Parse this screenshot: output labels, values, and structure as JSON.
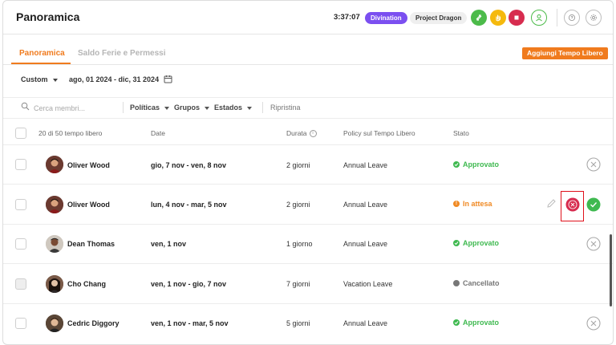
{
  "header": {
    "title": "Panoramica",
    "time": "3:37:07",
    "workspace_badge": "Divination",
    "project_badge": "Project Dragon",
    "icons": [
      "switch-icon",
      "hand-icon",
      "stop-icon",
      "user-icon",
      "help-icon",
      "settings-icon"
    ]
  },
  "tabs": [
    {
      "label": "Panoramica",
      "active": true
    },
    {
      "label": "Saldo Ferie e Permessi",
      "active": false
    }
  ],
  "add_button": "Aggiungi Tempo Libero",
  "range": {
    "preset": "Custom",
    "dates": "ago, 01 2024 - dic, 31 2024"
  },
  "filters": {
    "search_placeholder": "Cerca membri...",
    "policies": "Políticas",
    "groups": "Grupos",
    "states": "Estados",
    "reset": "Ripristina"
  },
  "table": {
    "headers": {
      "count": "20 di 50 tempo libero",
      "date": "Date",
      "duration": "Durata",
      "policy": "Policy sul Tempo Libero",
      "status": "Stato"
    },
    "rows": [
      {
        "name": "Oliver Wood",
        "date": "gio, 7 nov - ven, 8 nov",
        "duration": "2 giorni",
        "policy": "Annual Leave",
        "status": "Approvato",
        "status_color": "#3fb950"
      },
      {
        "name": "Oliver Wood",
        "date": "lun, 4 nov - mar, 5 nov",
        "duration": "2 giorni",
        "policy": "Annual Leave",
        "status": "In attesa",
        "status_color": "#f08a24"
      },
      {
        "name": "Dean Thomas",
        "date": "ven, 1 nov",
        "duration": "1 giorno",
        "policy": "Annual Leave",
        "status": "Approvato",
        "status_color": "#3fb950"
      },
      {
        "name": "Cho Chang",
        "date": "ven, 1 nov - gio, 7 nov",
        "duration": "7 giorni",
        "policy": "Vacation Leave",
        "status": "Cancellato",
        "status_color": "#777777"
      },
      {
        "name": "Cedric Diggory",
        "date": "ven, 1 nov - mar, 5 nov",
        "duration": "5 giorni",
        "policy": "Annual Leave",
        "status": "Approvato",
        "status_color": "#3fb950"
      }
    ]
  },
  "colors": {
    "accent": "#f07b1e",
    "purple": "#7b4ff0",
    "approved": "#3fb950",
    "pending": "#f08a24",
    "reject": "#d72c4f",
    "highlight_box": "#e0101a"
  }
}
